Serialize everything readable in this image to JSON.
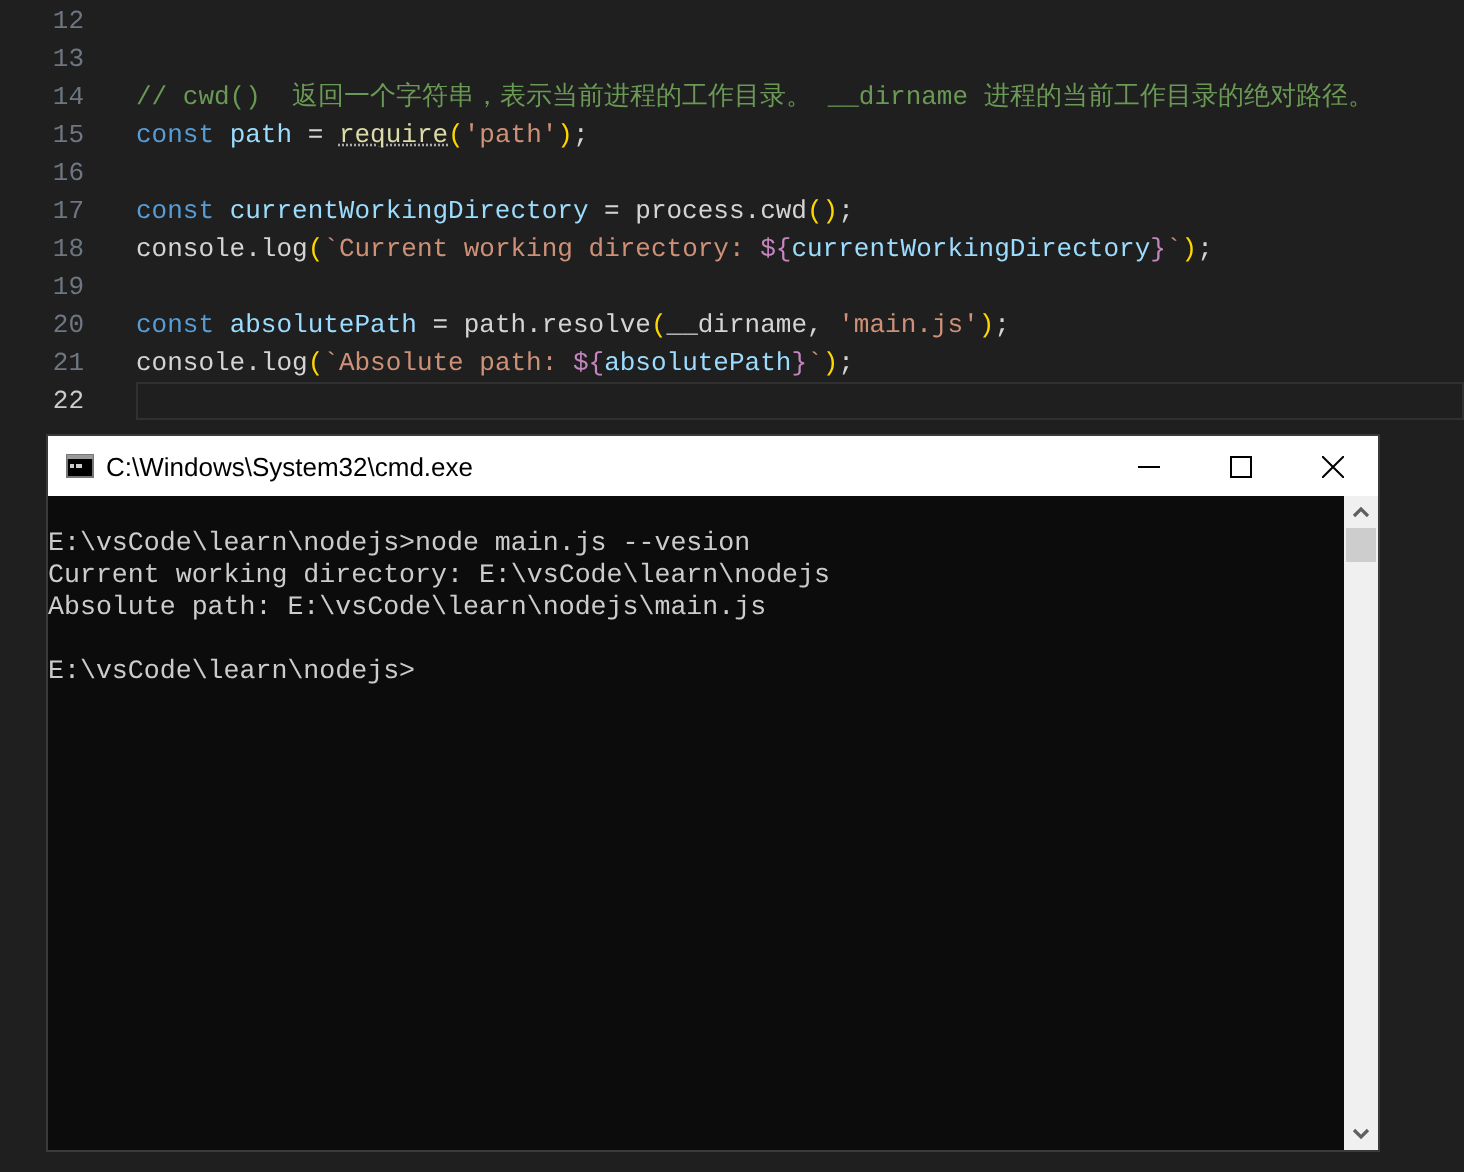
{
  "editor": {
    "lines": [
      {
        "number": "12",
        "current": false
      },
      {
        "number": "13",
        "current": false
      },
      {
        "number": "14",
        "current": false,
        "tokens": [
          {
            "kind": "comment",
            "text": "// cwd()  返回一个字符串，表示当前进程的工作目录。 __dirname 进程的当前工作目录的绝对路径。"
          }
        ]
      },
      {
        "number": "15",
        "current": false,
        "tokens": [
          {
            "kind": "keyword",
            "text": "const "
          },
          {
            "kind": "variable",
            "text": "path"
          },
          {
            "kind": "plain",
            "text": " = "
          },
          {
            "kind": "function-hinted",
            "text": "require"
          },
          {
            "kind": "bracket",
            "text": "("
          },
          {
            "kind": "string",
            "text": "'path'"
          },
          {
            "kind": "bracket",
            "text": ")"
          },
          {
            "kind": "plain",
            "text": ";"
          }
        ]
      },
      {
        "number": "16",
        "current": false
      },
      {
        "number": "17",
        "current": false,
        "tokens": [
          {
            "kind": "keyword",
            "text": "const "
          },
          {
            "kind": "variable",
            "text": "currentWorkingDirectory"
          },
          {
            "kind": "plain",
            "text": " = process.cwd"
          },
          {
            "kind": "bracket",
            "text": "()"
          },
          {
            "kind": "plain",
            "text": ";"
          }
        ]
      },
      {
        "number": "18",
        "current": false,
        "tokens": [
          {
            "kind": "plain",
            "text": "console.log"
          },
          {
            "kind": "bracket",
            "text": "("
          },
          {
            "kind": "string",
            "text": "`Current working directory: "
          },
          {
            "kind": "template",
            "text": "${"
          },
          {
            "kind": "variable",
            "text": "currentWorkingDirectory"
          },
          {
            "kind": "template",
            "text": "}"
          },
          {
            "kind": "string",
            "text": "`"
          },
          {
            "kind": "bracket",
            "text": ")"
          },
          {
            "kind": "plain",
            "text": ";"
          }
        ]
      },
      {
        "number": "19",
        "current": false
      },
      {
        "number": "20",
        "current": false,
        "tokens": [
          {
            "kind": "keyword",
            "text": "const "
          },
          {
            "kind": "variable",
            "text": "absolutePath"
          },
          {
            "kind": "plain",
            "text": " = path.resolve"
          },
          {
            "kind": "bracket",
            "text": "("
          },
          {
            "kind": "plain",
            "text": "__dirname, "
          },
          {
            "kind": "string",
            "text": "'main.js'"
          },
          {
            "kind": "bracket",
            "text": ")"
          },
          {
            "kind": "plain",
            "text": ";"
          }
        ]
      },
      {
        "number": "21",
        "current": false,
        "tokens": [
          {
            "kind": "plain",
            "text": "console.log"
          },
          {
            "kind": "bracket",
            "text": "("
          },
          {
            "kind": "string",
            "text": "`Absolute path: "
          },
          {
            "kind": "template",
            "text": "${"
          },
          {
            "kind": "variable",
            "text": "absolutePath"
          },
          {
            "kind": "template",
            "text": "}"
          },
          {
            "kind": "string",
            "text": "`"
          },
          {
            "kind": "bracket",
            "text": ")"
          },
          {
            "kind": "plain",
            "text": ";"
          }
        ]
      },
      {
        "number": "22",
        "current": true
      }
    ]
  },
  "console_window": {
    "title": "C:\\Windows\\System32\\cmd.exe",
    "output": [
      {
        "lines": [
          "E:\\vsCode\\learn\\nodejs>node main.js --vesion",
          "Current working directory: E:\\vsCode\\learn\\nodejs",
          "Absolute path: E:\\vsCode\\learn\\nodejs\\main.js"
        ]
      },
      {
        "lines": [
          "E:\\vsCode\\learn\\nodejs>"
        ]
      }
    ]
  }
}
